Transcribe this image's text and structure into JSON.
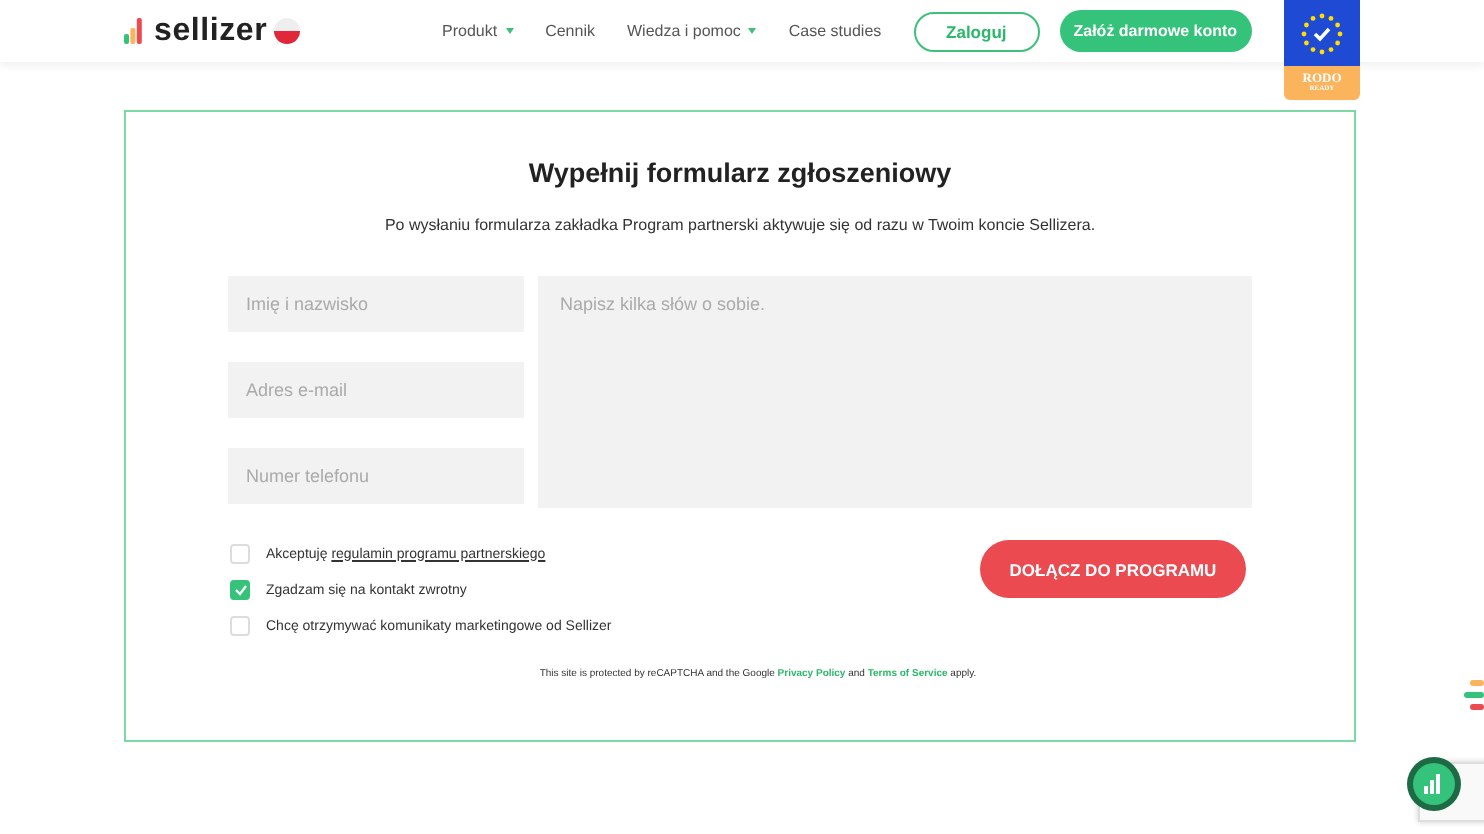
{
  "header": {
    "logo": "sellizer",
    "nav": [
      {
        "label": "Produkt",
        "dropdown": true
      },
      {
        "label": "Cennik",
        "dropdown": false
      },
      {
        "label": "Wiedza i pomoc",
        "dropdown": true
      },
      {
        "label": "Case studies",
        "dropdown": false
      }
    ],
    "login": "Zaloguj",
    "signup": "Załóż darmowe konto",
    "badge": {
      "title": "RODO",
      "subtitle": "READY"
    }
  },
  "form": {
    "title": "Wypełnij formularz zgłoszeniowy",
    "subtitle": "Po wysłaniu formularza zakładka Program partnerski aktywuje się od razu w Twoim koncie Sellizera.",
    "fields": [
      {
        "placeholder": "Imię i nazwisko"
      },
      {
        "placeholder": "Adres e-mail"
      },
      {
        "placeholder": "Numer telefonu"
      }
    ],
    "message": {
      "placeholder": "Napisz kilka słów o sobie."
    },
    "checkboxes": [
      {
        "text": "Akceptuję ",
        "link": "regulamin programu partnerskiego",
        "checked": false
      },
      {
        "text": "Zgadzam się na kontakt zwrotny",
        "checked": true
      },
      {
        "text": "Chcę otrzymywać komunikaty marketingowe od Sellizer",
        "checked": false
      }
    ],
    "submit": "DOŁĄCZ DO PROGRAMU",
    "recaptcha": {
      "before": "This site is protected by reCAPTCHA and the Google ",
      "privacy": "Privacy Policy",
      "and": " and ",
      "terms": "Terms of Service",
      "after": " apply."
    }
  }
}
